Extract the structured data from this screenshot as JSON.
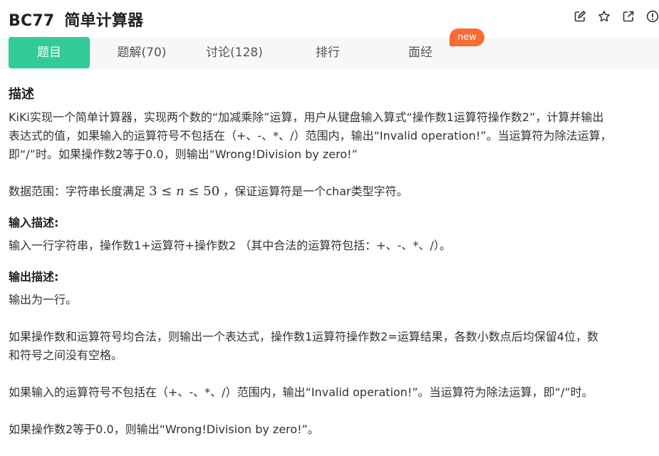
{
  "header": {
    "problem_id": "BC77",
    "problem_title": "简单计算器",
    "icons": [
      "edit-icon",
      "star-icon",
      "share-icon",
      "report-icon"
    ]
  },
  "tabs": [
    {
      "label": "题目",
      "active": true
    },
    {
      "label": "题解(70)",
      "active": false
    },
    {
      "label": "讨论(128)",
      "active": false
    },
    {
      "label": "排行",
      "active": false
    },
    {
      "label": "面经",
      "active": false,
      "badge": "new"
    }
  ],
  "colors": {
    "accent": "#32ca99",
    "badge": "#fa6b31"
  },
  "description": {
    "heading": "描述",
    "line1": "KiKi实现一个简单计算器，实现两个数的“加减乘除”运算，用户从键盘输入算式“操作数1运算符操作数2”，计算并输出",
    "line2": "表达式的值，如果输入的运算符号不包括在（+、-、*、/）范围内，输出“Invalid operation!”。当运算符为除法运算，",
    "line3": "即“/”时。如果操作数2等于0.0，则输出“Wrong!Division by zero!”",
    "range_prefix": "数据范围：字符串长度满足",
    "range_math_left": "3 ≤",
    "range_math_var": "n",
    "range_math_right": "≤ 50",
    "range_suffix": "，保证运算符是一个char类型字符。"
  },
  "input_desc": {
    "heading": "输入描述:",
    "text": "输入一行字符串，操作数1+运算符+操作数2 （其中合法的运算符包括：+、-、*、/）。"
  },
  "output_desc": {
    "heading": "输出描述:",
    "p1": "输出为一行。",
    "p2_line1": "如果操作数和运算符号均合法，则输出一个表达式，操作数1运算符操作数2=运算结果，各数小数点后均保留4位，数",
    "p2_line2": "和符号之间没有空格。",
    "p3": "如果输入的运算符号不包括在（+、-、*、/）范围内，输出“Invalid operation!”。当运算符为除法运算，即“/”时。",
    "p4": "如果操作数2等于0.0，则输出“Wrong!Division by zero!”。"
  }
}
